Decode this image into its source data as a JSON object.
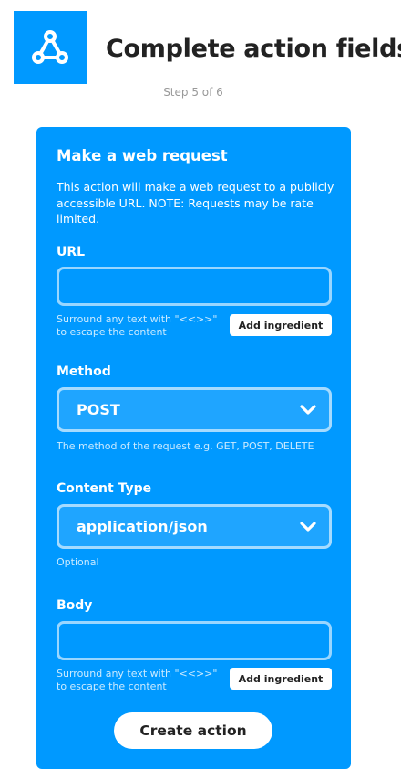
{
  "header": {
    "logo_icon": "webhooks-icon",
    "title": "Complete action fields",
    "step": "Step 5 of 6"
  },
  "card": {
    "title": "Make a web request",
    "description": "This action will make a web request to a publicly accessible URL. NOTE: Requests may be rate limited.",
    "url": {
      "label": "URL",
      "value": "",
      "hint": "Surround any text with \"<<>>\" to escape the content",
      "ingredient_button": "Add ingredient"
    },
    "method": {
      "label": "Method",
      "selected": "POST",
      "hint": "The method of the request e.g. GET, POST, DELETE"
    },
    "content_type": {
      "label": "Content Type",
      "selected": "application/json",
      "hint": "Optional"
    },
    "body": {
      "label": "Body",
      "value": "",
      "hint": "Surround any text with \"<<>>\" to escape the content",
      "ingredient_button": "Add ingredient"
    },
    "submit_label": "Create action"
  },
  "colors": {
    "brand_blue": "#0099ff",
    "title_text": "#222222",
    "step_text": "#999999",
    "white": "#ffffff"
  }
}
